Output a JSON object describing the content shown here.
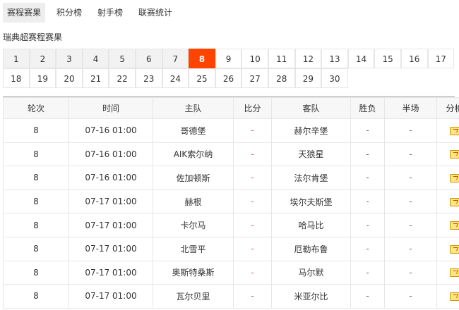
{
  "tabs": [
    "赛程赛果",
    "积分榜",
    "射手榜",
    "联赛统计"
  ],
  "subtitle": "瑞典超赛程赛果",
  "rounds": {
    "row1": [
      "1",
      "2",
      "3",
      "4",
      "5",
      "6",
      "7",
      "8",
      "9",
      "10",
      "11",
      "12",
      "13",
      "14",
      "15",
      "16",
      "17"
    ],
    "row2": [
      "18",
      "19",
      "20",
      "21",
      "22",
      "23",
      "24",
      "25",
      "26",
      "27",
      "28",
      "29",
      "30"
    ],
    "active": "8"
  },
  "table": {
    "headers": [
      "轮次",
      "时间",
      "主队",
      "比分",
      "客队",
      "胜负",
      "半场",
      "分析"
    ],
    "rows": [
      {
        "round": "8",
        "time": "07-16 01:00",
        "home": "哥德堡",
        "score": "-",
        "away": "赫尔辛堡",
        "result": "-",
        "half": "-"
      },
      {
        "round": "8",
        "time": "07-16 01:00",
        "home": "AIK索尔纳",
        "score": "-",
        "away": "天狼星",
        "result": "-",
        "half": "-"
      },
      {
        "round": "8",
        "time": "07-16 01:00",
        "home": "佐加顿斯",
        "score": "-",
        "away": "法尔肯堡",
        "result": "-",
        "half": "-"
      },
      {
        "round": "8",
        "time": "07-17 01:00",
        "home": "赫根",
        "score": "-",
        "away": "埃尔夫斯堡",
        "result": "-",
        "half": "-"
      },
      {
        "round": "8",
        "time": "07-17 01:00",
        "home": "卡尔马",
        "score": "-",
        "away": "哈马比",
        "result": "-",
        "half": "-"
      },
      {
        "round": "8",
        "time": "07-17 01:00",
        "home": "北雪平",
        "score": "-",
        "away": "厄勒布鲁",
        "result": "-",
        "half": "-"
      },
      {
        "round": "8",
        "time": "07-17 01:00",
        "home": "奥斯特桑斯",
        "score": "-",
        "away": "马尔默",
        "result": "-",
        "half": "-"
      },
      {
        "round": "8",
        "time": "07-17 01:00",
        "home": "瓦尔贝里",
        "score": "-",
        "away": "米亚尔比",
        "result": "-",
        "half": "-"
      }
    ]
  }
}
